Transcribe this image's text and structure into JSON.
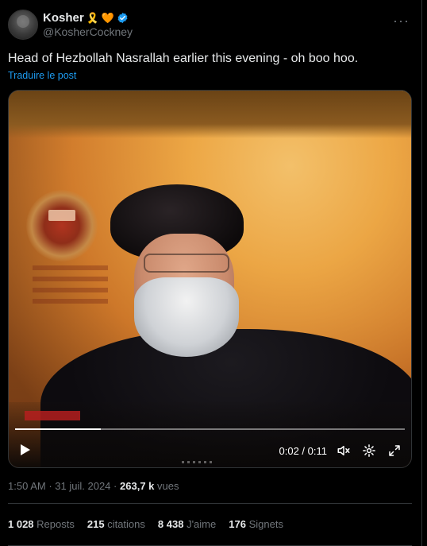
{
  "header": {
    "display_name": "Kosher",
    "emoji": [
      "🎗️",
      "🧡"
    ],
    "handle": "@KosherCockney"
  },
  "tweet": {
    "text": "Head of Hezbollah Nasrallah earlier this evening - oh boo hoo.",
    "translate_link": "Traduire le post"
  },
  "video": {
    "time": "0:02 / 0:11",
    "progress": 0.22,
    "icons": {
      "play": "play-icon",
      "volume": "volume-muted-icon",
      "settings": "settings-icon",
      "fullscreen": "fullscreen-icon"
    }
  },
  "meta": {
    "time": "1:50 AM",
    "separator": "·",
    "date": "31 juil. 2024",
    "views_count": "263,7 k",
    "views_label": "vues"
  },
  "stats": {
    "reposts_count": "1 028",
    "reposts_label": "Reposts",
    "quotes_count": "215",
    "quotes_label": "citations",
    "likes_count": "8 438",
    "likes_label": "J'aime",
    "bookmarks_count": "176",
    "bookmarks_label": "Signets"
  },
  "colors": {
    "accent": "#1d9bf0",
    "muted": "#71767b",
    "text": "#e7e9ea",
    "background": "#000000"
  }
}
